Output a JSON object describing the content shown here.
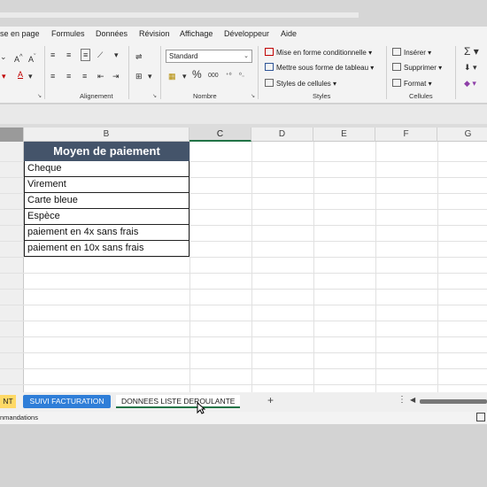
{
  "menu_tabs": [
    "se en page",
    "Formules",
    "Données",
    "Révision",
    "Affichage",
    "Développeur",
    "Aide"
  ],
  "ribbon": {
    "groups": {
      "alignment": "Alignement",
      "number": "Nombre",
      "styles": "Styles",
      "cells": "Cellules"
    },
    "number_format": "Standard",
    "styles_buttons": [
      "Mise en forme conditionnelle",
      "Mettre sous forme de tableau",
      "Styles de cellules"
    ],
    "cells_buttons": [
      "Insérer",
      "Supprimer",
      "Format"
    ],
    "percent_symbol": "%",
    "thousands_symbol": "000"
  },
  "columns": [
    "B",
    "C",
    "D",
    "E",
    "F",
    "G"
  ],
  "table": {
    "header": "Moyen de paiement",
    "rows": [
      "Cheque",
      "Virement",
      "Carte bleue",
      "Espèce",
      "paiement en 4x sans frais",
      "paiement en 10x sans frais"
    ]
  },
  "sheet_tabs": {
    "first": "NT",
    "second": "SUIVI FACTURATION",
    "active": "DONNEES LISTE DEROULANTE",
    "add": "+"
  },
  "status_text": "nmandations",
  "colors": {
    "header_fill": "#44546a",
    "accent_green": "#217346",
    "tab_blue": "#2f7ed8",
    "tab_yellow": "#ffd966"
  }
}
